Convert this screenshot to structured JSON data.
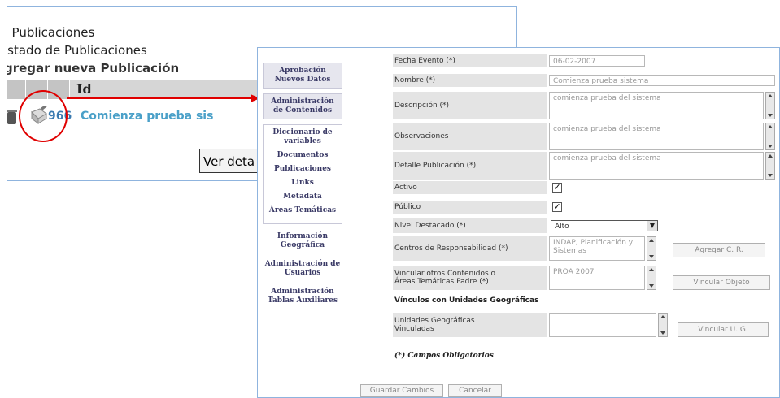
{
  "background_window": {
    "breadcrumb_1": ". Publicaciones",
    "breadcrumb_2": "istado de Publicaciones",
    "add_link": "gregar nueva Publicación",
    "column_id": "Id",
    "row": {
      "id": "966",
      "name": "Comienza prueba sis"
    },
    "tooltip_button": "Ver deta"
  },
  "sidebar": {
    "item_aprobacion": "Aprobación Nuevos Datos",
    "item_admin_contenidos": "Administración de Contenidos",
    "sub_items": [
      "Diccionario de variables",
      "Documentos",
      "Publicaciones",
      "Links",
      "Metadata",
      "Áreas Temáticas"
    ],
    "item_info_geo": "Información Geográfica",
    "item_admin_usuarios": "Administración de Usuarios",
    "item_admin_tablas": "Administración Tablas Auxiliares"
  },
  "form": {
    "fecha_label": "Fecha Evento (*)",
    "fecha_value": "06-02-2007",
    "nombre_label": "Nombre (*)",
    "nombre_value": "Comienza prueba sistema",
    "descripcion_label": "Descripción (*)",
    "descripcion_value": "comienza prueba del sistema",
    "observaciones_label": "Observaciones",
    "observaciones_value": "comienza prueba del sistema",
    "detalle_label": "Detalle Publicación (*)",
    "detalle_value": "comienza prueba del sistema",
    "activo_label": "Activo",
    "activo_checked": true,
    "publico_label": "Público",
    "publico_checked": true,
    "nivel_label": "Nivel Destacado (*)",
    "nivel_value": "Alto",
    "centros_label": "Centros de Responsabilidad (*)",
    "centros_value_1": "INDAP, Planificación y",
    "centros_value_2": "Sistemas",
    "agregar_cr_button": "Agregar C. R.",
    "vincular_label_1": "Vincular otros Contenidos o",
    "vincular_label_2": "Áreas Temáticas Padre (*)",
    "vincular_value": "PROA 2007",
    "vincular_objeto_button": "Vincular Objeto",
    "vinculos_heading": "Vínculos con Unidades Geográficas",
    "unidades_label_1": "Unidades Geográficas",
    "unidades_label_2": "Vinculadas",
    "vincular_ug_button": "Vincular U. G.",
    "required_note": "(*) Campos Obligatorios",
    "guardar_button": "Guardar Cambios",
    "cancelar_button": "Cancelar"
  },
  "colors": {
    "accent_red": "#e00000",
    "window_border": "#8fb4de",
    "label_bg": "#e4e4e4"
  }
}
